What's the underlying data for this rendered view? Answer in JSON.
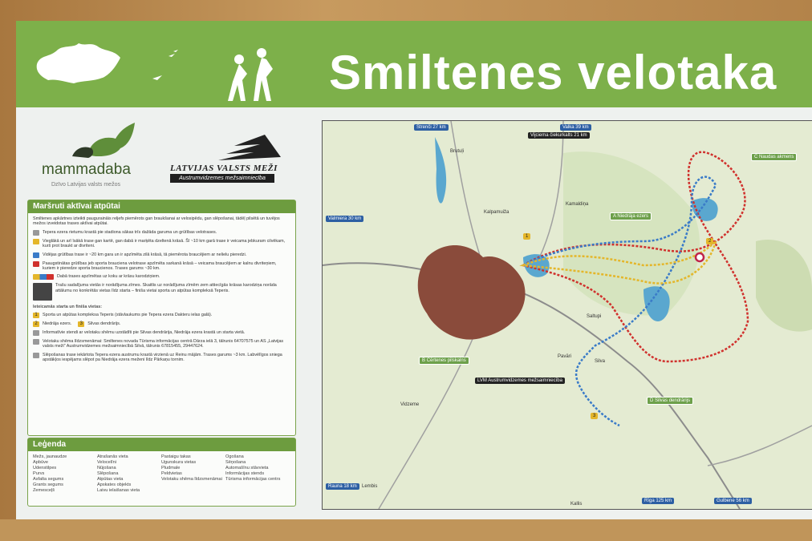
{
  "header": {
    "title": "Smiltenes velotaka"
  },
  "logos": {
    "mammadaba": "mammadaba",
    "mammadaba_sub": "Dzīvo Latvijas valsts mežos",
    "lvm_title": "LATVIJAS VALSTS MEŽI",
    "lvm_sub": "Austrumvidzemes mežsaimniecība"
  },
  "routes_panel": {
    "heading": "Maršruti aktīvai atpūtai",
    "intro": "Smiltenes apkārtnes izteikti pauguraināis reljefs piemērots gan braukšanai ar velosipēdu, gan slēpošanai, tādēļ pilsētā un tuvējos mežos izveidotas trases aktīvai atpūtai.",
    "items": [
      "Tepera ezera rietumu krastā pie stadiona sākas trīs dažāda garuma un grūtības velotrases.",
      "Vieglākā un arī īsākā trase gan kartē, gan dabā ir marķēta dzeltenā krāsā. Šī ~10 km garā trase ir veicama jebkuram cilvēkam, kurš prot braukt ar divriteni.",
      "Vidējas grūtības trase ir ~20 km gara un ir apzīmēta zilā krāsā, tā piemērota braucējiem ar nelielu pieredzi.",
      "Paaugstinātas grūtības jeb sporta brauciena velotrase apzīmēta sarkanā krāsā – veicama braucējiem ar kalnu divriteņiem, kuriem ir pieredze sporta braucienos. Trases garums ~30 km.",
      "Dabā trases apzīmētas uz koku ar krāsu karodziņiem.",
      "Trašu sadalījuma vietās ir norādījuma zīmes. Skaitlis uz norādījuma zīmēm zem attiecīgās krāsas karodziņa norāda attālumu no konkrētās vietas līdz starta – finiša vietai sporta un atpūtas kompleksā Teperis."
    ],
    "start_heading": "Ieteicamās starta un finiša vietas:",
    "starts": [
      "Sporta un atpūtas kompleksa Teperis (stāvlaukums pie Tepera ezera Dakteru ielas galā).",
      "Niedrāja ezers.",
      "Silvas dendrārijs.",
      "Informatīvie stendi ar velotaku shēmu uzstādīti pie Silvas dendrārija, Niedrāja ezera krastā un starta vietā."
    ],
    "info": "Velotaku shēma līdzsmenāmai: Smiltenes novada Tūrisma informācijas centrā Dārza ielā 3, tālrunis 64707575 un AS „Latvijas valsts meži\" Austrumvidzemes mežsaimniecībā Silvā, tālrunis 67815455, 29447624.",
    "ski": "Slēpošanas trase iekārtota Tepera ezera austrumu krastā virzienā uz Reinu mājām. Trases garums ~3 km. Labvēlīgos sniega apstākļos iespējams slēpot pa Niedrāja ezera meženi līdz Pārkaņu tornim."
  },
  "legend": {
    "heading": "Leģenda",
    "col1": [
      "Mežs, jaunaudze",
      "Apbūve",
      "Ūdenstilpes",
      "Purvs",
      "Asfalta segums",
      "Grants segums",
      "Zemesceļš"
    ],
    "col2": [
      "Atrašanās vieta",
      "Velocelīni",
      "Nūjošana",
      "Slēpošana",
      "Atpūtas vieta",
      "Apskates objekts",
      "Laivu ielaišanas vieta"
    ],
    "col3": [
      "Pastaigu takas",
      "Ugunskura vietas",
      "Pludmale",
      "Peldvietas",
      "Velotaku shēma līdzsmenāmai"
    ],
    "col4": [
      "Ogošana",
      "Sēņošana",
      "Automašīnu stāvvieta",
      "Informācijas stends",
      "Tūrisma informācijas centrs"
    ]
  },
  "map": {
    "labels": {
      "strenci": "Strenči 27 km",
      "valka": "Valka 39 km",
      "viciema": "Vijciema čiekurkalts 21 km",
      "valmiera": "Valmiera 30 km",
      "naudas": "Naudas akmens",
      "niedraja": "Niedrāja ezers",
      "cartenes": "Cērtenes pilskalns",
      "lvm": "LVM Austrumvidzemes mežsaimniecība",
      "silvas": "Silvas dendrārijs",
      "rauna": "Rauna 18 km",
      "riga": "Rīga 125 km",
      "gulbene": "Gulbene 56 km",
      "kalpamuiza": "Kalpamuiža",
      "brutuli": "Brutuļi",
      "kamaldina": "Kamaldiņa",
      "saltupi": "Saltupi",
      "pavari": "Pavāri",
      "silva": "Silva",
      "vidzeme": "Vidzeme",
      "lembis": "Lembis",
      "kallis": "Kallis",
      "letter_a": "A",
      "letter_b": "B",
      "letter_c": "C",
      "letter_d": "D",
      "num1": "1",
      "num2": "2",
      "num3": "3"
    }
  },
  "colors": {
    "green": "#7db04a",
    "route_red": "#d0312d",
    "route_blue": "#3a7bc8",
    "route_yellow": "#e4b62a",
    "town": "#8a4b3b"
  }
}
